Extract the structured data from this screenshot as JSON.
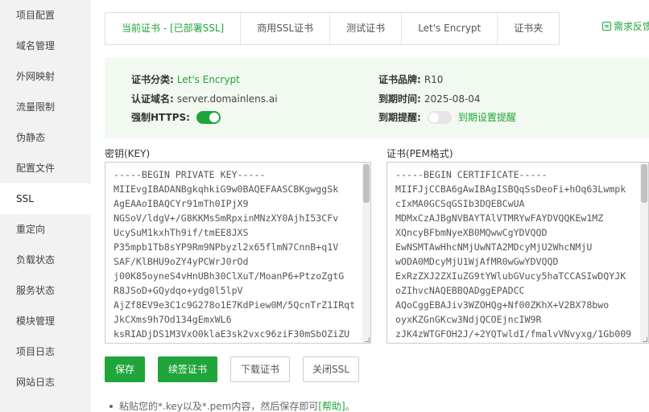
{
  "sidebar": {
    "items": [
      {
        "label": "项目配置"
      },
      {
        "label": "域名管理"
      },
      {
        "label": "外网映射"
      },
      {
        "label": "流量限制"
      },
      {
        "label": "伪静态"
      },
      {
        "label": "配置文件"
      },
      {
        "label": "SSL"
      },
      {
        "label": "重定向"
      },
      {
        "label": "负载状态"
      },
      {
        "label": "服务状态"
      },
      {
        "label": "模块管理"
      },
      {
        "label": "项目日志"
      },
      {
        "label": "网站日志"
      }
    ],
    "active_index": 6
  },
  "tabs": {
    "items": [
      {
        "label": "当前证书 - [已部署SSL]"
      },
      {
        "label": "商用SSL证书"
      },
      {
        "label": "测试证书"
      },
      {
        "label": "Let's Encrypt"
      },
      {
        "label": "证书夹"
      }
    ],
    "active_index": 0
  },
  "feedback": {
    "label": "需求反馈"
  },
  "cert_info": {
    "category_label": "证书分类:",
    "category_value": "Let's Encrypt",
    "brand_label": "证书品牌:",
    "brand_value": "R10",
    "domain_label": "认证域名:",
    "domain_value": "server.domainlens.ai",
    "expire_label": "到期时间:",
    "expire_value": "2025-08-04",
    "https_label": "强制HTTPS:",
    "https_enabled": true,
    "remind_label": "到期提醒:",
    "remind_enabled": false,
    "remind_link": "到期设置提醒"
  },
  "key_area": {
    "label": "密钥(KEY)",
    "lines": [
      "-----BEGIN PRIVATE KEY-----",
      "MIIEvgIBADANBgkqhkiG9w0BAQEFAASCBKgwggSk",
      "AgEAAoIBAQCYr91mTh0IPjX9",
      "NGSoV/ldgV+/G8KKMsSmRpxinMNzXY0AjhI53CFv",
      "UcySuM1kxhTh9if/tmEE8JXS",
      "P35mpb1Tb8sYP9Rm9NPbyzl2x65flmN7CnnB+q1V",
      "SAF/KlBHU9oZY4yPCWrJ0rOd",
      "j00K85oyneS4vHnUBh30ClXuT/MoanP6+PtzoZgtG",
      "R8JSoD+GQydqo+ydg0l5lpV",
      "AjZf8EV9e3C1c9G278o1E7KdPiew0M/5QcnTrZ1IRqt",
      "JkCXms9h7Od134gEmxWL6",
      "ksRIADjDS1M3VxO0klaE3sk2vxc96ziF30mSbOZiZU"
    ]
  },
  "cert_area": {
    "label": "证书(PEM格式)",
    "lines": [
      "-----BEGIN CERTIFICATE-----",
      "MIIFJjCCBA6gAwIBAgISBQqSsDeoFi+hOq63Lwmpk",
      "cIxMA0GCSqGSIb3DQEBCwUA",
      "MDMxCzAJBgNVBAYTAlVTMRYwFAYDVQQKEw1MZ",
      "XQncyBFbmNyeXB0MQwwCgYDVQQD",
      "EwNSMTAwHhcNMjUwNTA2MDcyMjU2WhcNMjU",
      "wODA0MDcyMjU1WjAfMR0wGwYDVQQD",
      "ExRzZXJ2ZXIuZG9tYWlubGVucy5haTCCASIwDQYJK",
      "oZIhvcNAQEBBQADggEPADCC",
      "AQoCggEBAJiv3WZOHQg+Nf00ZKhX+V2BX78bwo",
      "oyxKZGnGKcw3NdjQCOEjncIW9R",
      "zJK4zWTGFOH2J/+2YQTwldI/fmalvVNvyxg/1Gb009"
    ]
  },
  "buttons": {
    "save": "保存",
    "renew": "续签证书",
    "download": "下载证书",
    "close_ssl": "关闭SSL"
  },
  "tip": {
    "text": "粘贴您的*.key以及*.pem内容，然后保存即可",
    "link": "[帮助]",
    "suffix": "。"
  },
  "colors": {
    "accent": "#20a53a",
    "info_bg": "#f1f9f1"
  }
}
